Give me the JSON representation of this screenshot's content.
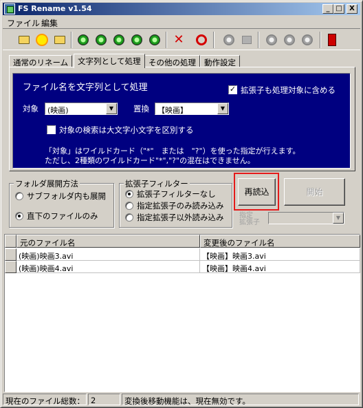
{
  "window": {
    "title": "FS Rename v1.54",
    "minimize": "_",
    "maximize": "□",
    "close": "X"
  },
  "menu": [
    "ファイル",
    "編集"
  ],
  "toolbar": {
    "icons": [
      "open-folder",
      "new-sun",
      "open-recent-folder",
      "green-circle",
      "green-circle",
      "green-circle",
      "green-circle",
      "green-circle",
      "delete-x",
      "undo",
      "gray-circle",
      "gray-folder",
      "gray-circle",
      "gray-circle",
      "gray-circle",
      "exit-device"
    ]
  },
  "tabs": [
    "通常のリネーム",
    "文字列として処理",
    "その他の処理",
    "動作設定"
  ],
  "panel": {
    "title": "ファイル名を文字列として処理",
    "include_ext_label": "拡張子も処理対象に含める",
    "include_ext_checked": true,
    "target_label": "対象",
    "target_value": "(映画)",
    "replace_label": "置換",
    "replace_value": "【映画】",
    "case_label": "対象の検索は大文字小文字を区別する",
    "case_checked": false,
    "note1": "「対象」はワイルドカード（\"*\"　または　\"?\"）を使った指定が行えます。",
    "note2": "ただし、2種類のワイルドカード\"*\",\"?\"の混在はできません。"
  },
  "folder_group": {
    "legend": "フォルダ展開方法",
    "options": [
      "サブフォルダ内も展開",
      "直下のファイルのみ"
    ],
    "selected": 1
  },
  "ext_group": {
    "legend": "拡張子フィルター",
    "options": [
      "拡張子フィルターなし",
      "指定拡張子のみ読み込み",
      "指定拡張子以外読み込み"
    ],
    "selected": 0
  },
  "buttons": {
    "reload": "再読込",
    "start": "開始"
  },
  "ext_select_label_1": "指定",
  "ext_select_label_2": "拡張子",
  "list": {
    "columns": [
      "元のファイル名",
      "変更後のファイル名"
    ],
    "rows": [
      [
        "(映画)映画3.avi",
        "【映画】映画3.avi"
      ],
      [
        "(映画)映画4.avi",
        "【映画】映画4.avi"
      ]
    ]
  },
  "status": {
    "count_label": "現在のファイル総数：",
    "count_value": "2",
    "message": "変換後移動機能は、現在無効です。"
  }
}
